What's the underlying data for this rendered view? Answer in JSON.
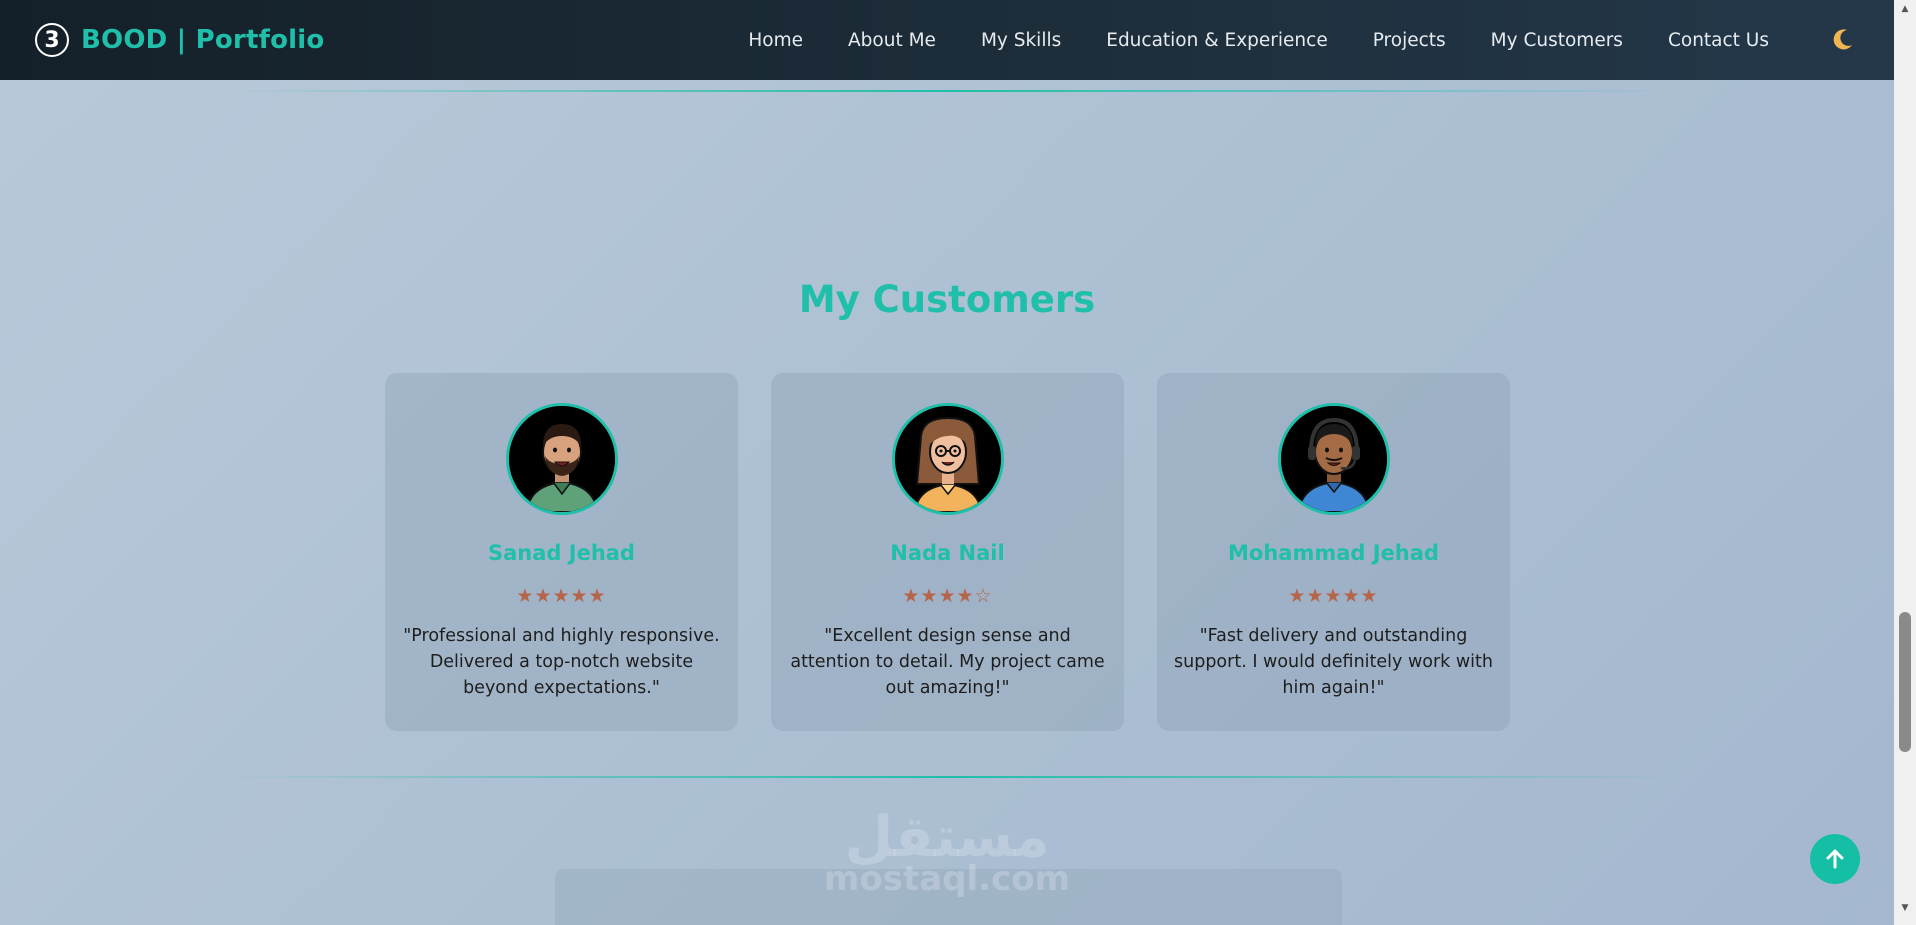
{
  "brand": {
    "badge": "3",
    "name": "BOOD | Portfolio"
  },
  "nav": {
    "links": [
      "Home",
      "About Me",
      "My Skills",
      "Education & Experience",
      "Projects",
      "My Customers",
      "Contact Us"
    ],
    "theme_icon": "moon-icon"
  },
  "section": {
    "title": "My Customers"
  },
  "customers": [
    {
      "name": "Sanad Jehad",
      "stars": "★★★★★",
      "rating": 5,
      "review": "\"Professional and highly responsive. Delivered a top-notch website beyond expectations.\""
    },
    {
      "name": "Nada Nail",
      "stars": "★★★★☆",
      "rating": 4,
      "review": "\"Excellent design sense and attention to detail. My project came out amazing!\""
    },
    {
      "name": "Mohammad Jehad",
      "stars": "★★★★★",
      "rating": 5,
      "review": "\"Fast delivery and outstanding support. I would definitely work with him again!\""
    }
  ],
  "watermark": {
    "arabic": "مستقل",
    "latin": "mostaql.com"
  },
  "colors": {
    "accent": "#1fbfa9",
    "star": "#b5654a",
    "nav_bg": "#1c2c38"
  },
  "scroll_to_top_icon": "arrow-up-icon"
}
